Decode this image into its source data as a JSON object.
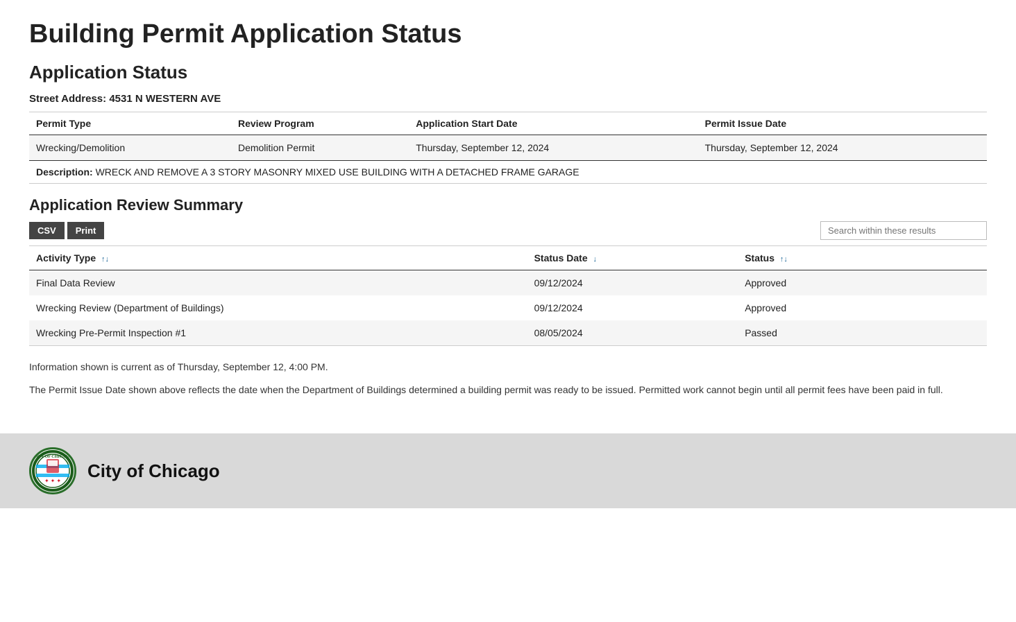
{
  "page": {
    "title": "Building Permit Application Status",
    "section_title": "Application Status",
    "street_address_label": "Street Address:",
    "street_address_value": "4531 N WESTERN AVE"
  },
  "permit_table": {
    "columns": [
      "Permit Type",
      "Review Program",
      "Application Start Date",
      "Permit Issue Date"
    ],
    "rows": [
      {
        "permit_type": "Wrecking/Demolition",
        "review_program": "Demolition Permit",
        "application_start_date": "Thursday, September 12, 2024",
        "permit_issue_date": "Thursday, September 12, 2024"
      }
    ]
  },
  "description": {
    "label": "Description:",
    "value": "WRECK AND REMOVE A 3 STORY MASONRY MIXED USE BUILDING WITH A DETACHED FRAME GARAGE"
  },
  "review_summary": {
    "title": "Application Review Summary",
    "csv_button": "CSV",
    "print_button": "Print",
    "search_placeholder": "Search within these results",
    "columns": {
      "activity_type": "Activity Type",
      "status_date": "Status Date",
      "status": "Status"
    },
    "rows": [
      {
        "activity_type": "Final Data Review",
        "status_date": "09/12/2024",
        "status": "Approved"
      },
      {
        "activity_type": "Wrecking Review (Department of Buildings)",
        "status_date": "09/12/2024",
        "status": "Approved"
      },
      {
        "activity_type": "Wrecking Pre-Permit Inspection #1",
        "status_date": "08/05/2024",
        "status": "Passed"
      }
    ]
  },
  "footer_notes": {
    "note1": "Information shown is current as of Thursday, September 12, 4:00 PM.",
    "note2": "The Permit Issue Date shown above reflects the date when the Department of Buildings determined a building permit was ready to be issued. Permitted work cannot begin until all permit fees have been paid in full."
  },
  "footer": {
    "city_name": "City of Chicago"
  }
}
